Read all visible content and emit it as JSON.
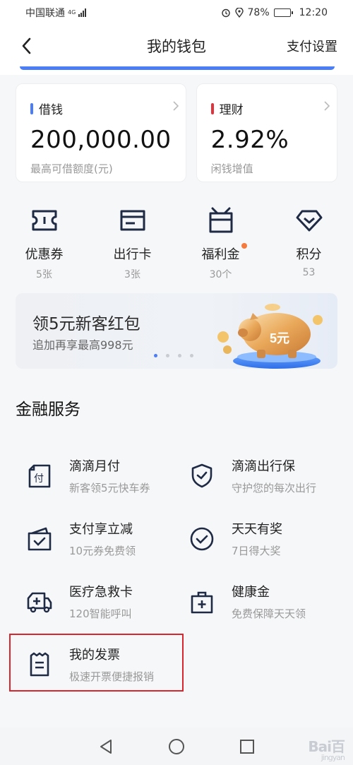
{
  "status_bar": {
    "carrier": "中国联通",
    "network": "4G",
    "battery": "78%",
    "battery_level": 0.78,
    "time": "12:20"
  },
  "nav": {
    "title": "我的钱包",
    "settings": "支付设置"
  },
  "cards": [
    {
      "label": "借钱",
      "value": "200,000.00",
      "sub": "最高可借额度(元)",
      "accent": "#4a7df6"
    },
    {
      "label": "理财",
      "value": "2.92%",
      "sub": "闲钱增值",
      "accent": "#e0343c"
    }
  ],
  "quick_items": [
    {
      "icon": "ticket-icon",
      "label": "优惠券",
      "count": "5张",
      "badge": false
    },
    {
      "icon": "travel-card-icon",
      "label": "出行卡",
      "count": "3张",
      "badge": false
    },
    {
      "icon": "gift-box-icon",
      "label": "福利金",
      "count": "30个",
      "badge": true
    },
    {
      "icon": "diamond-icon",
      "label": "积分",
      "count": "53",
      "badge": false
    }
  ],
  "banner": {
    "title": "领5元新客红包",
    "subtitle": "追加再享最高998元",
    "coin_text": "5元",
    "page_count": 4,
    "active_index": 0
  },
  "finance": {
    "title": "金融服务",
    "services": [
      {
        "icon": "payment-receipt-icon",
        "title": "滴滴月付",
        "subtitle": "新客领5元快车券"
      },
      {
        "icon": "shield-icon",
        "title": "滴滴出行保",
        "subtitle": "守护您的每次出行"
      },
      {
        "icon": "wallet-check-icon",
        "title": "支付享立减",
        "subtitle": "10元券免费领"
      },
      {
        "icon": "check-circle-icon",
        "title": "天天有奖",
        "subtitle": "7日得大奖"
      },
      {
        "icon": "ambulance-icon",
        "title": "医疗急救卡",
        "subtitle": "120智能呼叫"
      },
      {
        "icon": "medical-kit-icon",
        "title": "健康金",
        "subtitle": "免费保障天天领"
      },
      {
        "icon": "invoice-icon",
        "title": "我的发票",
        "subtitle": "极速开票便捷报销"
      }
    ]
  },
  "colors": {
    "accent_blue": "#4a7df6",
    "accent_red": "#e0343c",
    "badge_orange": "#f57a3d",
    "highlight_red": "#d9262e"
  }
}
